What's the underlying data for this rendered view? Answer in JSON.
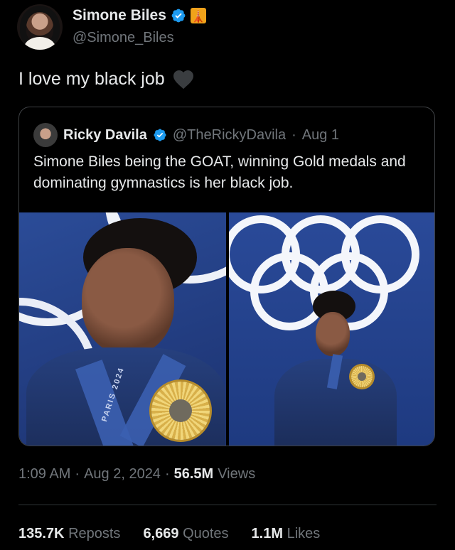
{
  "author": {
    "name": "Simone Biles",
    "handle": "@Simone_Biles",
    "tower_emoji": "🗼"
  },
  "tweet": {
    "text": "I love my black job"
  },
  "quote": {
    "name": "Ricky Davila",
    "handle": "@TheRickyDavila",
    "separator": "·",
    "date": "Aug 1",
    "text": "Simone Biles being the GOAT, winning Gold medals and dominating gymnastics is her black job.",
    "photo1_caption": "PARIS 2024"
  },
  "meta": {
    "time": "1:09 AM",
    "sep1": "·",
    "date": "Aug 2, 2024",
    "sep2": "·",
    "views_count": "56.5M",
    "views_label": "Views"
  },
  "stats": {
    "reposts_count": "135.7K",
    "reposts_label": "Reposts",
    "quotes_count": "6,669",
    "quotes_label": "Quotes",
    "likes_count": "1.1M",
    "likes_label": "Likes"
  },
  "colors": {
    "background": "#000000",
    "text": "#e7e9ea",
    "secondary": "#71767b",
    "verified": "#1d9bf0",
    "border": "#3e4144"
  },
  "icons": {
    "verified": "verified-badge-icon",
    "heart": "black-heart-icon",
    "tower": "tokyo-tower-emoji-icon"
  }
}
